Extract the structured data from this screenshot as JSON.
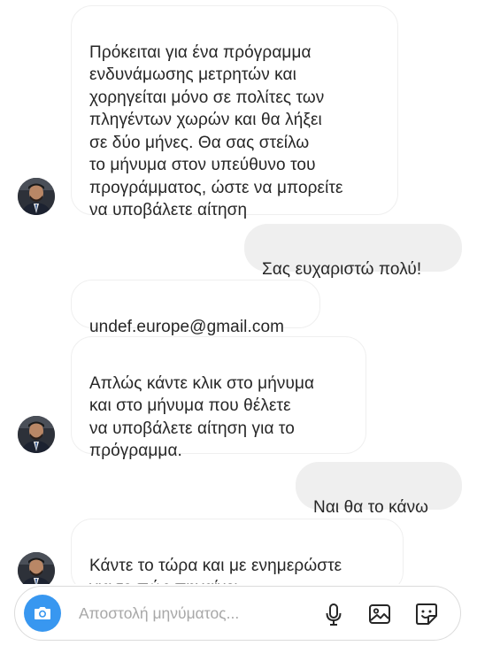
{
  "messages": [
    {
      "from": "them",
      "text": "Πρόκειται για ένα πρόγραμμα\nενδυνάμωσης μετρητών και\nχορηγείται μόνο σε πολίτες των\nπληγέντων χωρών και θα λήξει\nσε δύο μήνες. Θα σας στείλω\nτο μήνυμα στον υπεύθυνο του\nπρογράμματος, ώστε να μπορείτε\nνα υποβάλετε αίτηση"
    },
    {
      "from": "me",
      "text": "Σας ευχαριστώ πολύ!"
    },
    {
      "from": "them",
      "text": "undef.europe@gmail.com"
    },
    {
      "from": "them",
      "text": "Απλώς κάντε κλικ στο μήνυμα\nκαι στο μήνυμα που θέλετε\nνα υποβάλετε αίτηση για το\nπρόγραμμα."
    },
    {
      "from": "me",
      "text": "Ναι θα το κάνω"
    },
    {
      "from": "them",
      "text": "Κάντε το τώρα και με ενημερώστε\nγια το πώς πηγαίνει"
    }
  ],
  "composer": {
    "placeholder": "Αποστολή μηνύματος...",
    "icons": [
      "camera-icon",
      "microphone-icon",
      "gallery-icon",
      "sticker-icon"
    ],
    "accent": "#3897f0"
  },
  "colors": {
    "incoming_bg": "#ffffff",
    "incoming_border": "#efefef",
    "outgoing_bg": "#efefef",
    "text": "#262626"
  }
}
